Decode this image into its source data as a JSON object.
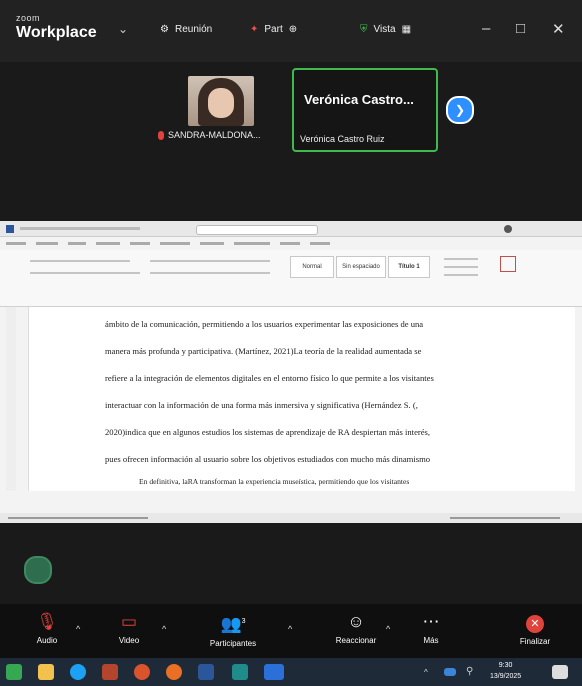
{
  "app": {
    "brand_small": "zoom",
    "brand": "Workplace"
  },
  "titlebar": {
    "reunion_label": "Reunión",
    "part_label": "Part",
    "vista_label": "Vista",
    "minimize": "–",
    "maximize": "□",
    "close": "✕"
  },
  "participants": [
    {
      "name": "SANDRA-MALDONA..."
    },
    {
      "display_name": "Verónica Castro...",
      "name": "Verónica Castro Ruiz"
    }
  ],
  "document": {
    "style_normal": "Normal",
    "style_no_spacing": "Sin espaciado",
    "style_title1": "Título 1",
    "lines": [
      "ámbito de la comunicación, permitiendo a los usuarios experimentar las exposiciones de una",
      "manera más profunda y participativa. (Martínez, 2021)La teoría de la realidad aumentada se",
      "refiere a la integración de elementos digitales en el entorno físico lo que permite a los visitantes",
      "interactuar con la información de una forma más inmersiva y significativa (Hernández S. (,",
      "2020)indica que en algunos estudios los sistemas de aprendizaje de RA despiertan más interés,",
      "pues ofrecen información al usuario sobre los objetivos estudiados con mucho más dinamismo",
      "En definitiva, laRA transforman la experiencia museística, permitiendo que los visitantes"
    ]
  },
  "toolbar": {
    "audio": "Audio",
    "video": "Video",
    "participants": "Participantes",
    "participants_count": "3",
    "reactions": "Reaccionar",
    "more": "Más",
    "end": "Finalizar"
  },
  "taskbar": {
    "time": "9:30",
    "date": "13/9/2025"
  },
  "colors": {
    "active_speaker": "#41b94e",
    "end_red": "#e0433b",
    "accent_blue": "#2e8fff"
  }
}
